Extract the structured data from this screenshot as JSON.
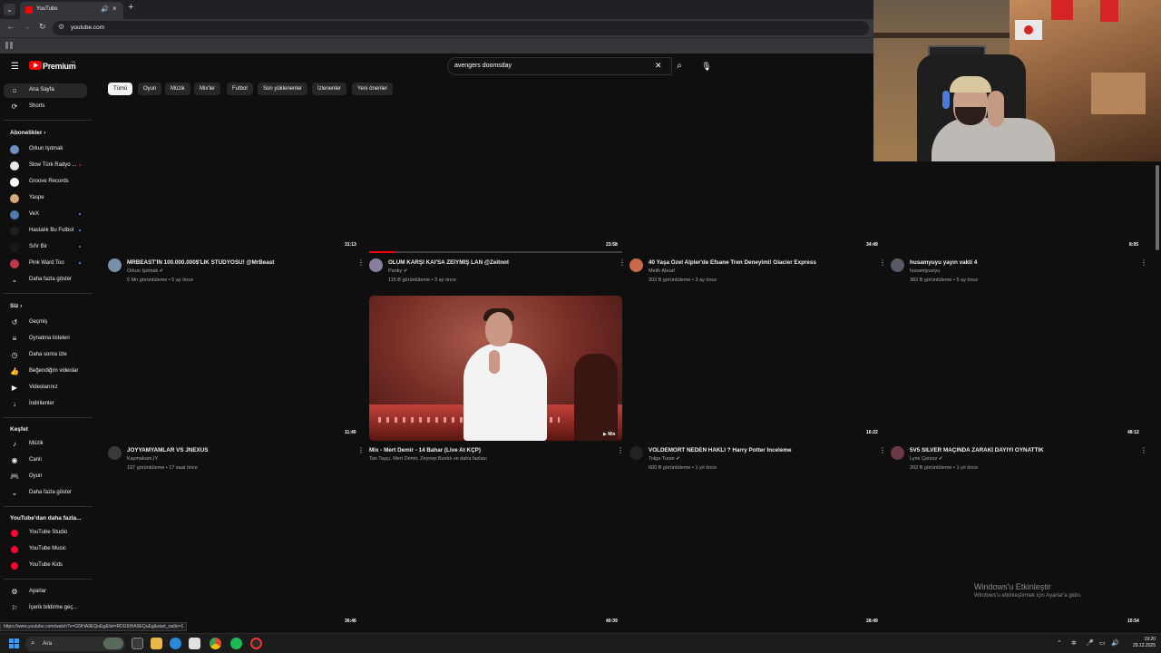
{
  "browser": {
    "tab_title": "YouTube",
    "url": "youtube.com"
  },
  "masthead": {
    "logo_text": "Premium",
    "logo_sup": "TR",
    "search_value": "avengers doomsday"
  },
  "sidebar": {
    "main": [
      {
        "label": "Ana Sayfa",
        "icon": "home-icon"
      },
      {
        "label": "Shorts",
        "icon": "shorts-icon"
      }
    ],
    "subs_header": "Abonelikler",
    "subs": [
      {
        "label": "Orkun Işıtmak",
        "color": "#6b8fbf"
      },
      {
        "label": "Slow Türk Radyo ...",
        "color": "#e8e8e8"
      },
      {
        "label": "Groove Records",
        "color": "#ffffff"
      },
      {
        "label": "Yaspe",
        "color": "#d8a87a"
      },
      {
        "label": "VeX",
        "color": "#4c7bb0"
      },
      {
        "label": "Hastalık Bu Futbol",
        "color": "#202020"
      },
      {
        "label": "Sıfır Bir",
        "color": "#1a1a1a"
      },
      {
        "label": "Pink Ward Too",
        "color": "#c0394b"
      }
    ],
    "subs_more": "Daha fazla göster",
    "you_header": "Siz",
    "you": [
      {
        "label": "Geçmiş",
        "icon": "history-icon"
      },
      {
        "label": "Oynatma listeleri",
        "icon": "playlist-icon"
      },
      {
        "label": "Daha sonra izle",
        "icon": "clock-icon"
      },
      {
        "label": "Beğendiğim videolar",
        "icon": "like-icon"
      },
      {
        "label": "Videolarınız",
        "icon": "video-icon"
      },
      {
        "label": "İndirilenler",
        "icon": "download-icon"
      }
    ],
    "explore_header": "Keşfet",
    "explore": [
      {
        "label": "Müzik",
        "icon": "music-icon"
      },
      {
        "label": "Canlı",
        "icon": "live-icon"
      },
      {
        "label": "Oyun",
        "icon": "game-icon"
      }
    ],
    "explore_more": "Daha fazla göster",
    "more_header": "YouTube'dan daha fazla...",
    "more": [
      {
        "label": "YouTube Studio"
      },
      {
        "label": "YouTube Music"
      },
      {
        "label": "YouTube Kids"
      }
    ],
    "settings": [
      {
        "label": "Ayarlar",
        "icon": "gear-icon"
      },
      {
        "label": "İçerik bildirme geç...",
        "icon": "flag-icon"
      }
    ]
  },
  "chips": [
    "Tümü",
    "Oyun",
    "Müzik",
    "Mix'ler",
    "Futbol",
    "Son yüklenenler",
    "İzlenenler",
    "Yeni öneriler"
  ],
  "row1_durations": [
    "31:13",
    "23:58",
    "34:49",
    "8:05"
  ],
  "row1": [
    {
      "title": "MRBEAST'İN 100.000.000$'LIK STÜDYOSU! @MrBeast",
      "channel": "Orkun Işıtmak",
      "verified": "✔",
      "meta": "5 Mn görüntüleme • 5 ay önce",
      "avatar": "#7a8fa8"
    },
    {
      "title": "OLUM KARŞI KAI'SA ZEİYMİŞ LAN @Zeitnot",
      "channel": "Panky",
      "verified": "✔",
      "meta": "115 B görüntüleme • 3 ay önce",
      "avatar": "#8b7fa0"
    },
    {
      "title": "40 Yaşa Özel Alpler'de Efsane Tren Deneyimi! Glacier Express",
      "channel": "Melih Abuaf",
      "verified": "",
      "meta": "202 B görüntüleme • 3 ay önce",
      "avatar": "#c86a4a"
    },
    {
      "title": "husamyuyu yayın vakti 4",
      "channel": "husamlyuviyu",
      "verified": "",
      "meta": "382 B görüntüleme • 5 ay önce",
      "avatar": "#555a66"
    }
  ],
  "watch_progress": 0.1,
  "row2_durations": [
    "11:40",
    "16:22",
    "48:12"
  ],
  "row2": [
    {
      "title": "JOYYAMYAMLAR VS JNEXUS",
      "channel": "Kaymakam,IY",
      "verified": "",
      "meta": "197 görüntüleme • 17 saat önce",
      "avatar": "#3a3a3a"
    },
    {
      "title": "Mix - Mert Demir - 14 Bahar (Live At KÇP)",
      "channel": "Tan Taşçı, Mert Demir, Zeynep Bastık ve daha fazlası",
      "verified": "",
      "meta": "",
      "avatar": ""
    },
    {
      "title": "VOLDEMORT NEDEN HAKLI ? Harry Potter İnceleme",
      "channel": "Tolga Turan",
      "verified": "✔",
      "meta": "600 B görüntüleme • 1 yıl önce",
      "avatar": "#222222"
    },
    {
      "title": "5V5 SILVER MAÇINDA ZARAKİ DAYIYI OYNATTIK",
      "channel": "Lynx Çerezz",
      "verified": "✔",
      "meta": "202 B görüntüleme • 1 yıl önce",
      "avatar": "#6a3a44"
    }
  ],
  "mix_badge": "Mix",
  "row3_durations": [
    "36:46",
    "40:39",
    "28:49",
    "15:54"
  ],
  "watermark": {
    "line1": "Windows'u Etkinleştir",
    "line2": "Windows'u etkinleştirmek için Ayarlar'a gidin."
  },
  "status_url": "https://www.youtube.com/watch?v=G5IHA9EQuEg&list=RDG5IHA9EQuEg&start_radio=1",
  "taskbar": {
    "search_label": "Ara",
    "time": "19:20",
    "date": "29.12.2025"
  }
}
